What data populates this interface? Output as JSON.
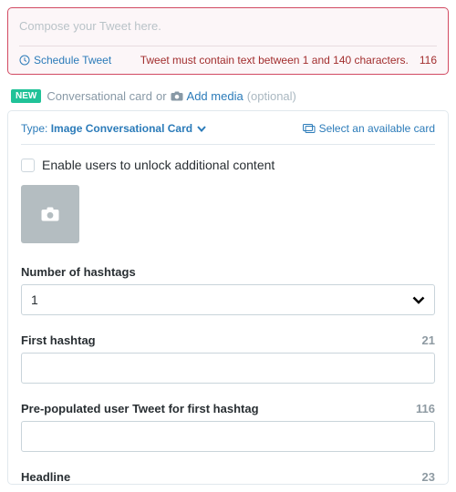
{
  "compose": {
    "placeholder": "Compose your Tweet here.",
    "schedule_label": "Schedule Tweet",
    "error": "Tweet must contain text between 1 and 140 characters.",
    "remaining": "116"
  },
  "card_header": {
    "new_badge": "NEW",
    "label": "Conversational card",
    "or": "or",
    "add_media": "Add media",
    "optional": "(optional)"
  },
  "card": {
    "type_label": "Type:",
    "type_value": "Image Conversational Card",
    "select_available": "Select an available card",
    "enable_unlock": "Enable users to unlock additional content",
    "hashtags_label": "Number of hashtags",
    "hashtags_value": "1",
    "first_hashtag_label": "First hashtag",
    "first_hashtag_counter": "21",
    "pretweet_label": "Pre-populated user Tweet for first hashtag",
    "pretweet_counter": "116",
    "headline_label": "Headline",
    "headline_counter": "23"
  }
}
